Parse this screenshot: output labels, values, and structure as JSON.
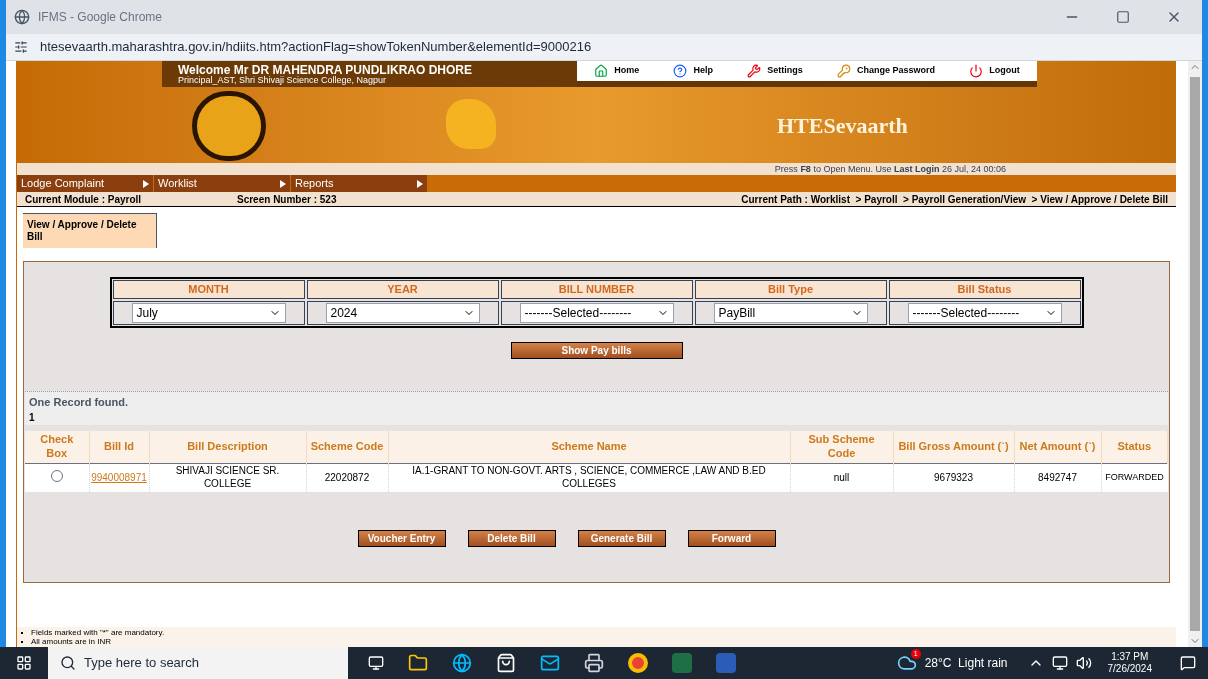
{
  "browser": {
    "title": "IFMS - Google Chrome",
    "url": "htesevaarth.maharashtra.gov.in/hdiits.htm?actionFlag=showTokenNumber&elementId=9000216"
  },
  "header": {
    "welcome": "Welcome Mr DR MAHENDRA PUNDLIKRAO DHORE",
    "designation": "Principal_AST, Shri Shivaji Science College, Nagpur",
    "brand": "HTESevaarth",
    "top_links": [
      {
        "label": "Home",
        "kind": "home"
      },
      {
        "label": "Help",
        "kind": "help"
      },
      {
        "label": "Settings",
        "kind": "settings"
      },
      {
        "label": "Change Password",
        "kind": "key"
      },
      {
        "label": "Logout",
        "kind": "power"
      }
    ],
    "hint": "Press **F8** to Open Menu. Use **Last Login** 26 Jul, 24 00:06"
  },
  "menu": [
    {
      "label": "Lodge Complaint"
    },
    {
      "label": "Worklist"
    },
    {
      "label": "Reports"
    }
  ],
  "status": {
    "module": "Current Module : Payroll",
    "screen": "Screen Number : 523",
    "path": "Current Path : Worklist  > Payroll  > Payroll Generation/View  > View / Approve / Delete Bill"
  },
  "tabs": [
    {
      "label": "View / Approve / Delete Bill",
      "selected": true
    }
  ],
  "filters": [
    {
      "label": "MONTH",
      "value": "July"
    },
    {
      "label": "YEAR",
      "value": "2024"
    },
    {
      "label": "BILL NUMBER",
      "value": "-------Selected--------"
    },
    {
      "label": "Bill Type",
      "value": "PayBill"
    },
    {
      "label": "Bill Status",
      "value": "-------Selected--------"
    }
  ],
  "show_button": "Show Pay bills",
  "result": {
    "message": "One Record found.",
    "page": "1"
  },
  "table": {
    "columns": [
      "Check Box",
      "Bill Id",
      "Bill Description",
      "Scheme Code",
      "Scheme Name",
      "Sub Scheme Code",
      "Bill Gross Amount (`)",
      "Net Amount (`)",
      "Status"
    ],
    "rows": [
      {
        "selected": false,
        "bill_id": "9940008971",
        "description": "SHIVAJI SCIENCE SR. COLLEGE",
        "scheme_code": "22020872",
        "scheme_name": "IA.1-GRANT TO NON-GOVT. ARTS , SCIENCE, COMMERCE ,LAW AND B.ED COLLEGES",
        "sub_scheme_code": "null",
        "gross": "9679323",
        "net": "8492747",
        "status": "FORWARDED"
      }
    ]
  },
  "actions": [
    "Voucher Entry",
    "Delete Bill",
    "Generate Bill",
    "Forward"
  ],
  "footer": {
    "notes": [
      "Fields marked with \"*\" are mandatory.",
      "All amounts are in INR"
    ]
  },
  "taskbar": {
    "search": "Type here to search",
    "weather": "28°C  Light rain",
    "time": "1:37 PM",
    "date": "7/26/2024",
    "notification_count": "1"
  }
}
